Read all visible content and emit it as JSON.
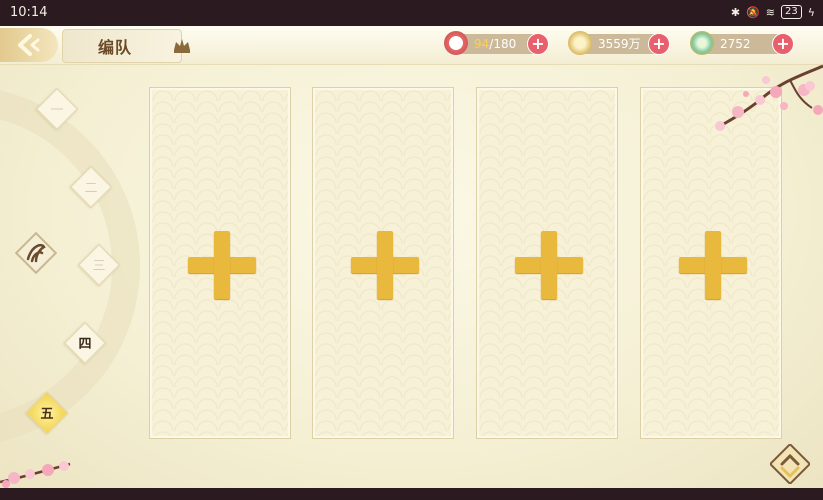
{
  "status_bar": {
    "time": "10:14",
    "battery": "23"
  },
  "header": {
    "title": "编队"
  },
  "resources": {
    "stamina": {
      "current": "94",
      "max": "/180"
    },
    "coins": {
      "value": "3559万"
    },
    "jade": {
      "value": "2752"
    },
    "plus_label": "+"
  },
  "team_tabs": [
    {
      "label": "一",
      "state": "normal"
    },
    {
      "label": "二",
      "state": "normal"
    },
    {
      "label": "三",
      "state": "normal"
    },
    {
      "label": "四",
      "state": "dark"
    },
    {
      "label": "五",
      "state": "active"
    }
  ],
  "slots": [
    {
      "icon": "plus-icon"
    },
    {
      "icon": "plus-icon"
    },
    {
      "icon": "plus-icon"
    },
    {
      "icon": "plus-icon"
    }
  ],
  "colors": {
    "accent": "#e9b93e",
    "plus_button": "#e8606c",
    "bar": "#2b1a1f"
  }
}
